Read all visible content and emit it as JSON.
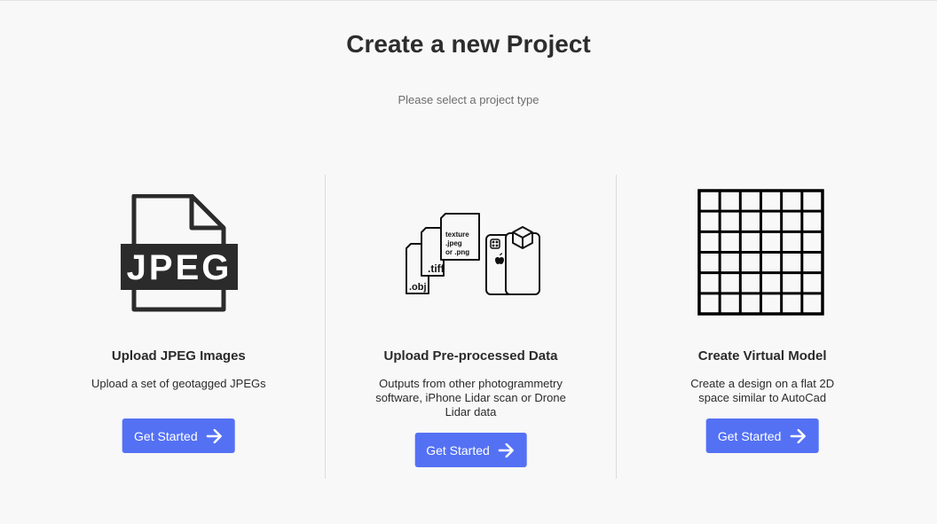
{
  "header": {
    "title": "Create a new Project",
    "subtitle": "Please select a project type"
  },
  "cards": [
    {
      "icon": "jpeg-file-icon",
      "icon_text": "JPEG",
      "title": "Upload JPEG Images",
      "description": "Upload a set of geotagged JPEGs",
      "button_label": "Get Started"
    },
    {
      "icon": "preprocessed-data-icon",
      "icon_labels": [
        ".obj",
        ".tiff",
        "texture",
        ".jpeg",
        "or .png"
      ],
      "title": "Upload Pre-processed Data",
      "description": "Outputs from other photogrammetry software, iPhone Lidar scan or Drone Lidar data",
      "button_label": "Get Started"
    },
    {
      "icon": "grid-icon",
      "grid": {
        "rows": 6,
        "cols": 6
      },
      "title": "Create Virtual Model",
      "description": "Create a design on a flat 2D space similar to AutoCad",
      "button_label": "Get Started"
    }
  ],
  "colors": {
    "background": "#f8f8f8",
    "button": "#5471f4",
    "divider": "#dcdcdc",
    "subtitle": "#6d6d6d"
  }
}
